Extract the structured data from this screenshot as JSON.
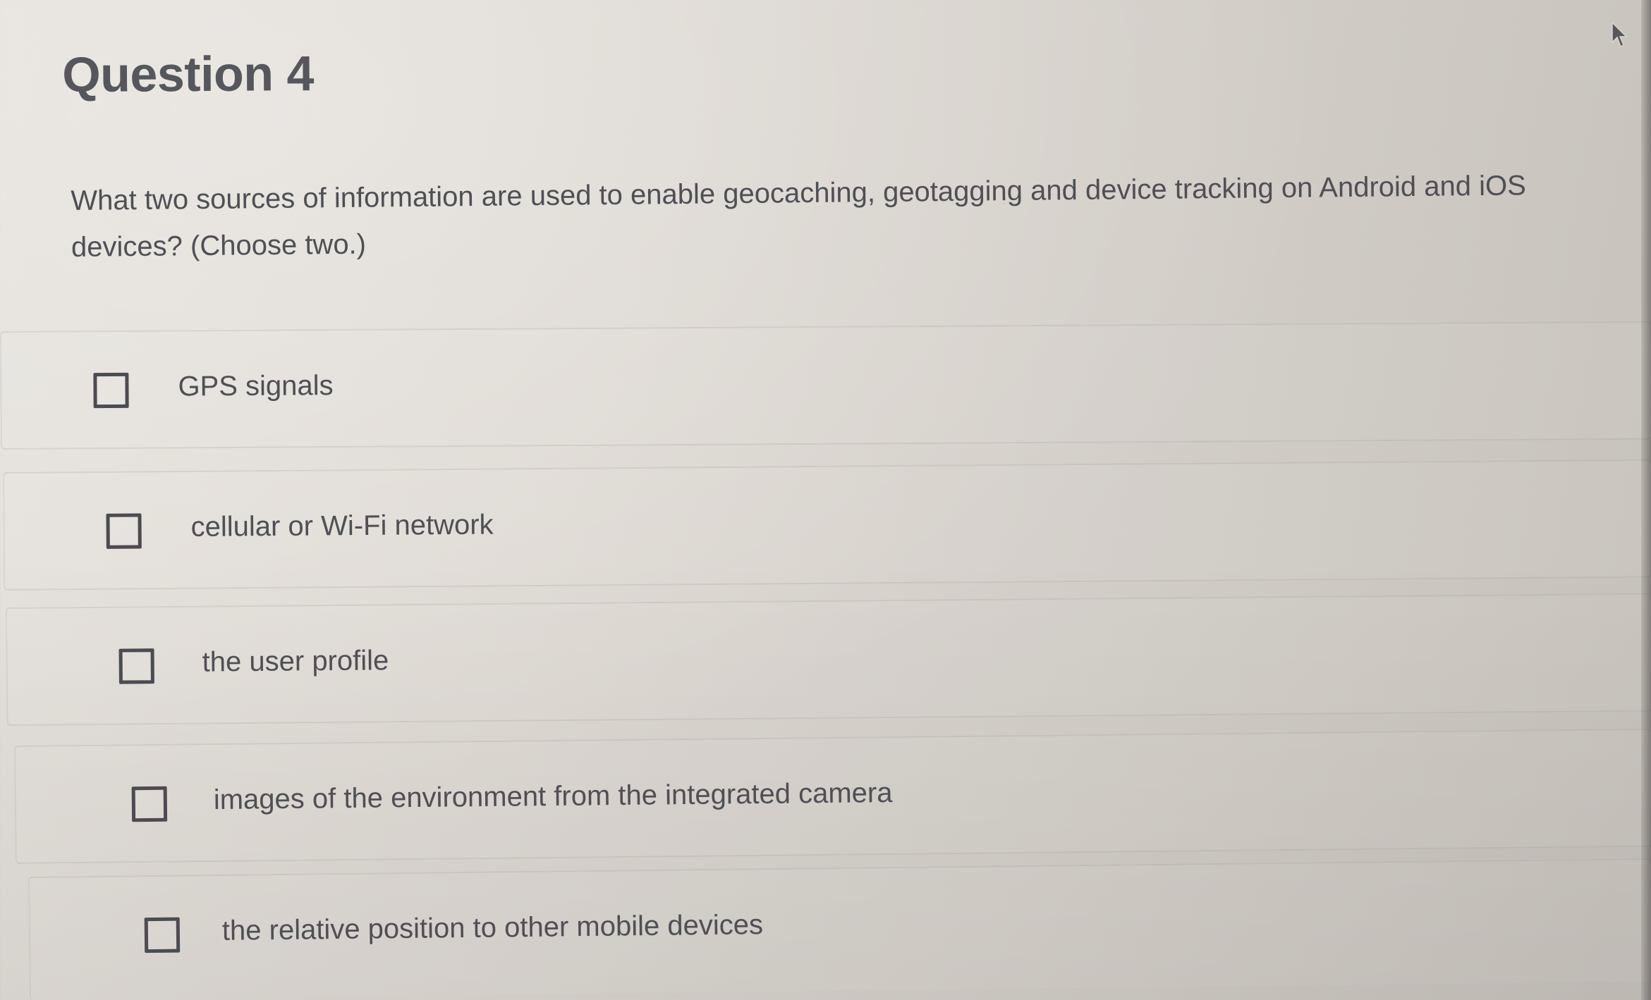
{
  "question": {
    "title": "Question 4",
    "prompt": "What two sources of information are used to enable geocaching, geotagging and device tracking on Android and iOS devices? (Choose two.)"
  },
  "options": [
    {
      "label": "GPS signals",
      "checked": false
    },
    {
      "label": "cellular or Wi-Fi network",
      "checked": false
    },
    {
      "label": "the user profile",
      "checked": false
    },
    {
      "label": "images of the environment from the integrated camera",
      "checked": false
    },
    {
      "label": "the relative position to other mobile devices",
      "checked": false
    }
  ],
  "icons": {
    "cursor": "mouse-pointer-icon"
  }
}
